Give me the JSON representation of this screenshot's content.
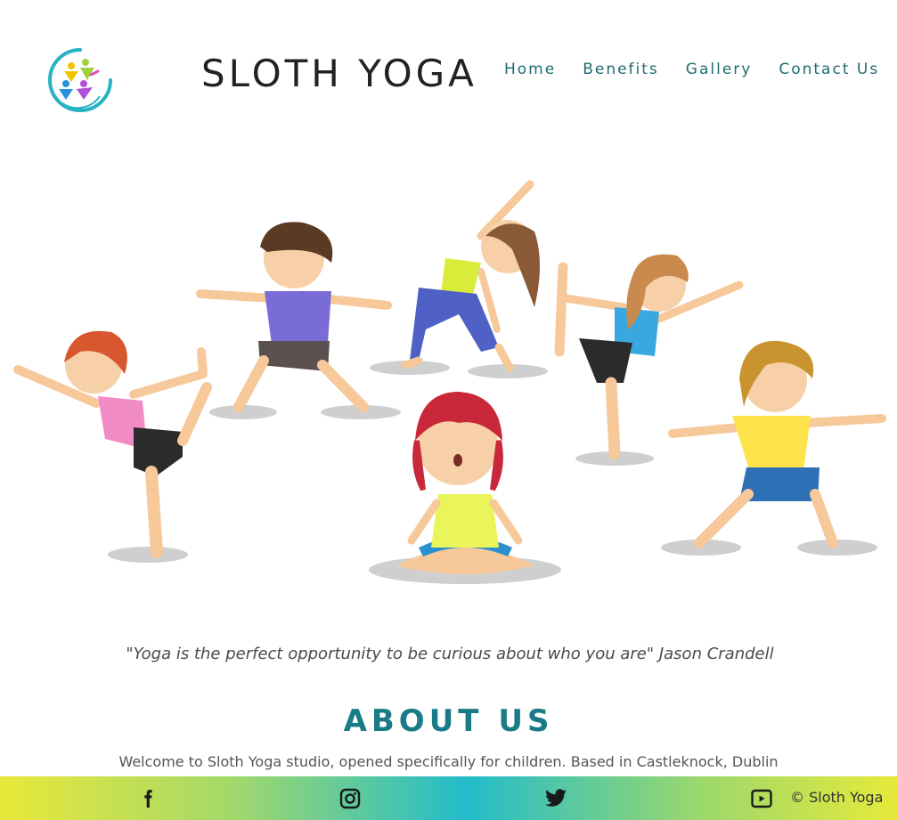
{
  "header": {
    "brand": "SLOTH YOGA",
    "nav": {
      "home": "Home",
      "benefits": "Benefits",
      "gallery": "Gallery",
      "contact": "Contact Us"
    }
  },
  "hero": {
    "illustration": "children-doing-yoga-illustration"
  },
  "main": {
    "quote": "\"Yoga is the perfect opportunity to be curious about who you are\" Jason Crandell",
    "about_title": "ABOUT US",
    "about_text": "Welcome to Sloth Yoga studio, opened specifically for children. Based in Castleknock, Dublin"
  },
  "footer": {
    "icons": [
      "facebook-icon",
      "instagram-icon",
      "twitter-icon",
      "youtube-icon"
    ],
    "copyright": "© Sloth Yoga"
  },
  "colors": {
    "accent": "#1a7a87",
    "nav": "#1f6b72",
    "footer_gradient": [
      "#e9e83a",
      "#22bccb",
      "#e6ea3a"
    ]
  }
}
